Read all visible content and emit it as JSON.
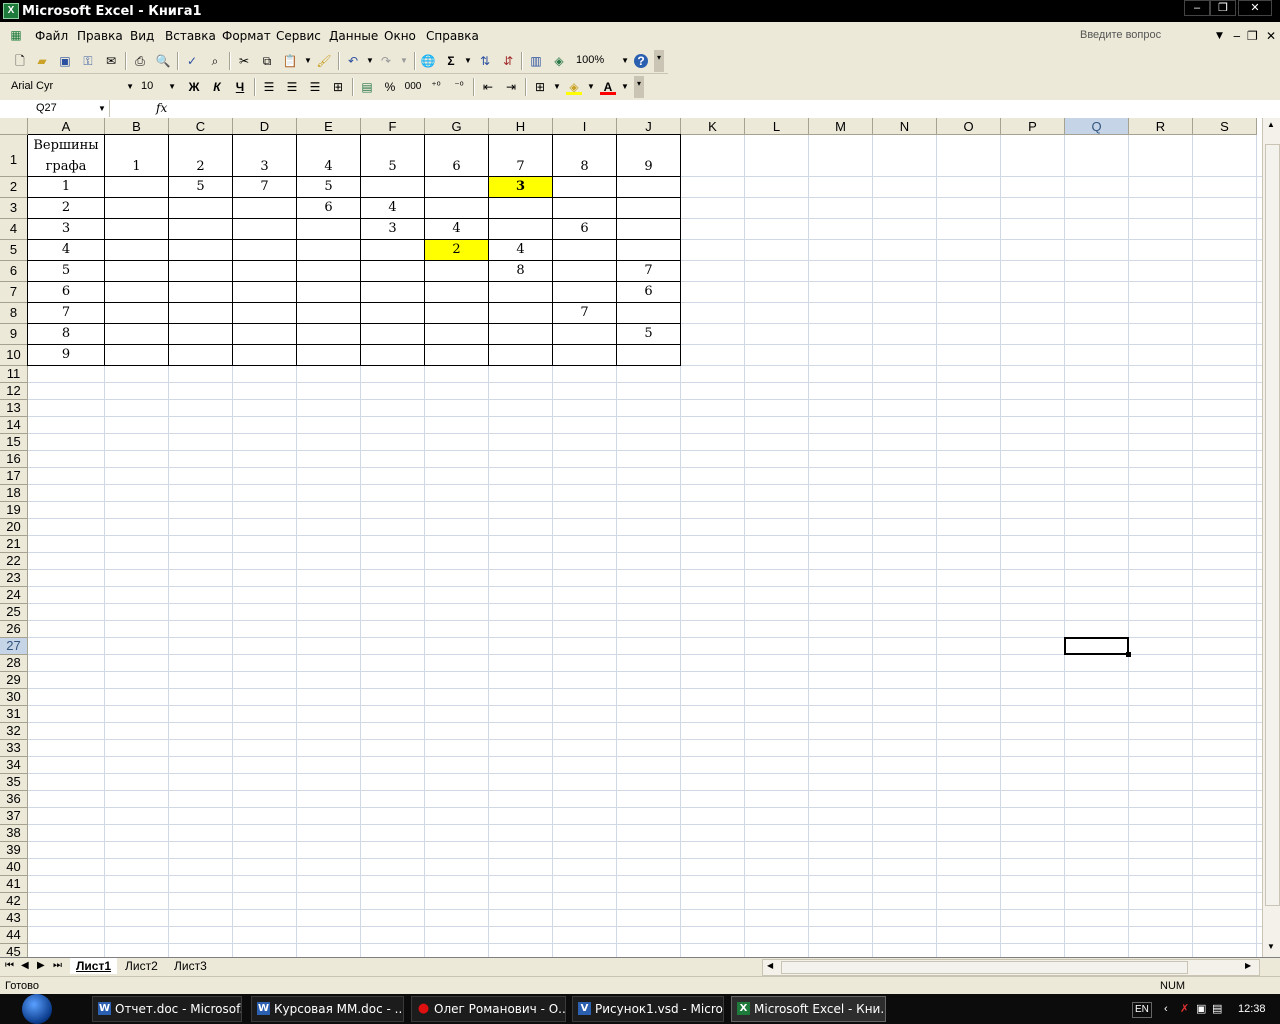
{
  "window": {
    "title": "Microsoft Excel - Книга1",
    "min": "‒",
    "max": "❐",
    "close": "✕"
  },
  "menu": {
    "items": [
      "Файл",
      "Правка",
      "Вид",
      "Вставка",
      "Формат",
      "Сервис",
      "Данные",
      "Окно",
      "Справка"
    ],
    "help_placeholder": "Введите вопрос"
  },
  "toolbar": {
    "zoom": "100%",
    "font_name": "Arial Cyr",
    "font_size": "10",
    "bold": "Ж",
    "italic": "К",
    "underline": "Ч",
    "sum": "Σ",
    "percent": "%",
    "thousands": "000"
  },
  "formula_bar": {
    "name_box": "Q27",
    "fx": "fx",
    "content": ""
  },
  "columns": [
    "A",
    "B",
    "C",
    "D",
    "E",
    "F",
    "G",
    "H",
    "I",
    "J",
    "K",
    "L",
    "M",
    "N",
    "O",
    "P",
    "Q",
    "R",
    "S"
  ],
  "rows": [
    "1",
    "2",
    "3",
    "4",
    "5",
    "6",
    "7",
    "8",
    "9",
    "10",
    "11",
    "12",
    "13",
    "14",
    "15",
    "16",
    "17",
    "18",
    "19",
    "20",
    "21",
    "22",
    "23",
    "24",
    "25",
    "26",
    "27",
    "28",
    "29",
    "30",
    "31",
    "32",
    "33",
    "34",
    "35",
    "36",
    "37",
    "38",
    "39",
    "40",
    "41",
    "42",
    "43",
    "44",
    "45"
  ],
  "selected": {
    "column": "Q",
    "row": "27"
  },
  "table": {
    "header_line1": "Вершины",
    "header_line2": "графа",
    "col_labels": [
      "1",
      "2",
      "3",
      "4",
      "5",
      "6",
      "7",
      "8",
      "9"
    ],
    "row_labels": [
      "1",
      "2",
      "3",
      "4",
      "5",
      "6",
      "7",
      "8",
      "9"
    ],
    "values": [
      [
        "",
        "5",
        "7",
        "5",
        "",
        "",
        "3",
        "",
        ""
      ],
      [
        "",
        "",
        "",
        "6",
        "4",
        "",
        "",
        "",
        ""
      ],
      [
        "",
        "",
        "",
        "",
        "3",
        "4",
        "",
        "6",
        ""
      ],
      [
        "",
        "",
        "",
        "",
        "",
        "2",
        "4",
        "",
        ""
      ],
      [
        "",
        "",
        "",
        "",
        "",
        "",
        "8",
        "",
        "7"
      ],
      [
        "",
        "",
        "",
        "",
        "",
        "",
        "",
        "",
        "6"
      ],
      [
        "",
        "",
        "",
        "",
        "",
        "",
        "",
        "7",
        ""
      ],
      [
        "",
        "",
        "",
        "",
        "",
        "",
        "",
        "",
        "5"
      ],
      [
        "",
        "",
        "",
        "",
        "",
        "",
        "",
        "",
        ""
      ]
    ],
    "highlight_color": "#ffff00"
  },
  "sheets": [
    "Лист1",
    "Лист2",
    "Лист3"
  ],
  "status": {
    "left": "Готово",
    "right": "NUM"
  },
  "taskbar": {
    "tasks": [
      "Отчет.doc - Microsof...",
      "Курсовая ММ.doc - ...",
      "Олег Романович - О...",
      "Рисунок1.vsd - Micro...",
      "Microsoft Excel - Кни..."
    ],
    "lang": "EN",
    "clock": "12:38"
  }
}
